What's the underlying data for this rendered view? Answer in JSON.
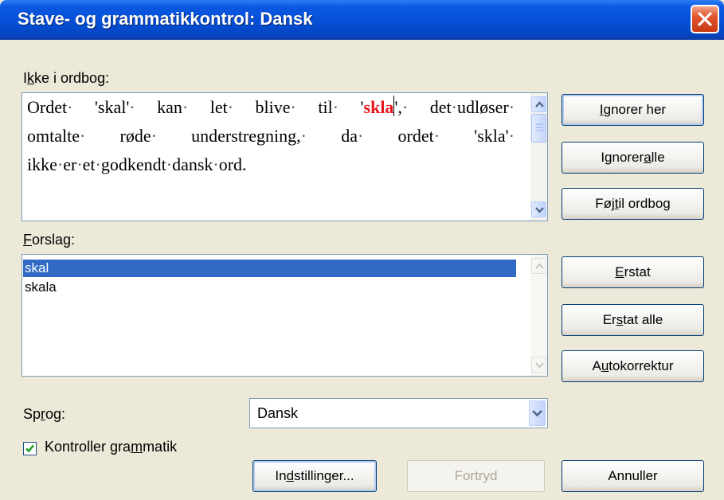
{
  "window": {
    "title": "Stave- og grammatikkontrol: Dansk"
  },
  "not_in_dictionary": {
    "label_pre": "I",
    "label_acc": "k",
    "label_post": "ke i ordbog:",
    "lines": [
      [
        "Ordet",
        "'skal'",
        "kan",
        "let",
        "blive",
        "til"
      ],
      [
        "omtalte",
        "røde",
        "understregning,",
        "da",
        "ordet",
        "'skla'"
      ],
      [
        "ikke",
        "er",
        "et",
        "godkendt",
        "dansk",
        "ord."
      ]
    ],
    "line1_tail_before": "'",
    "error_word": "skla",
    "line1_tail_after": "',",
    "line1_rest": [
      "det",
      "udløser"
    ]
  },
  "suggestions": {
    "label_pre": "",
    "label_acc": "F",
    "label_post": "orslag:",
    "items": [
      "skal",
      "skala"
    ],
    "selected_index": 0
  },
  "language": {
    "label_pre": "Sp",
    "label_acc": "r",
    "label_post": "og:",
    "value": "Dansk"
  },
  "grammar_check": {
    "checked": true,
    "label_pre": "Kontroller gra",
    "label_acc": "m",
    "label_post": "matik"
  },
  "buttons": {
    "ignore_once": {
      "pre": "",
      "acc": "I",
      "post": "gnorer her"
    },
    "ignore_all": {
      "pre": "Ignorer ",
      "acc": "a",
      "post": "lle"
    },
    "add_to_dictionary": {
      "pre": "Føj ",
      "acc": "t",
      "post": "il ordbog"
    },
    "change": {
      "pre": "",
      "acc": "E",
      "post": "rstat"
    },
    "change_all": {
      "pre": "Er",
      "acc": "s",
      "post": "tat alle"
    },
    "autocorrect": {
      "pre": "A",
      "acc": "u",
      "post": "tokorrektur"
    },
    "options": {
      "pre": "In",
      "acc": "d",
      "post": "stillinger..."
    },
    "undo": {
      "label": "Fortryd"
    },
    "cancel": {
      "label": "Annuller"
    }
  },
  "colors": {
    "title_bar": "#0551d8",
    "dialog_bg": "#ece9d8",
    "error_word": "#e8161a",
    "selection": "#316ac5",
    "close_button": "#e2552d"
  },
  "icons": [
    "close-icon",
    "scroll-up-arrow-icon",
    "scroll-down-arrow-icon",
    "dropdown-arrow-icon",
    "checkmark-icon"
  ]
}
